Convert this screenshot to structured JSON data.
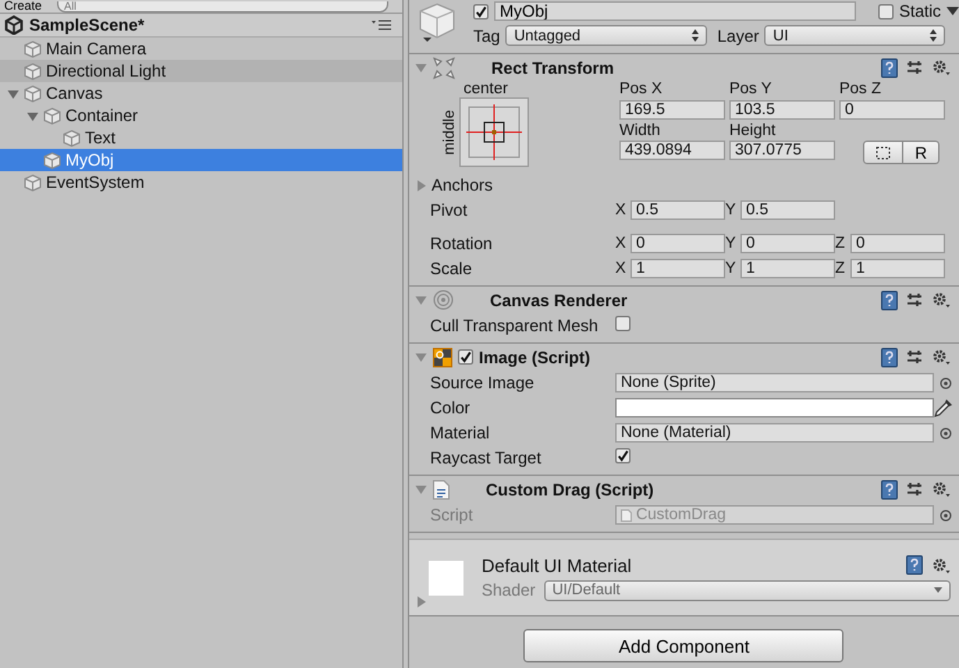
{
  "hierarchy": {
    "toolbar": {
      "create_label": "Create",
      "search_placeholder": "All"
    },
    "scene": {
      "name": "SampleScene*"
    },
    "items": [
      {
        "name": "Main Camera",
        "selected": false,
        "highlighted": false
      },
      {
        "name": "Directional Light",
        "selected": false,
        "highlighted": true
      },
      {
        "name": "Canvas",
        "selected": false,
        "highlighted": false,
        "expanded": true,
        "children": [
          {
            "name": "Container",
            "selected": false,
            "highlighted": false,
            "expanded": true,
            "children": [
              {
                "name": "Text",
                "selected": false,
                "highlighted": false
              }
            ]
          },
          {
            "name": "MyObj",
            "selected": true,
            "highlighted": false
          }
        ]
      },
      {
        "name": "EventSystem",
        "selected": false,
        "highlighted": false
      }
    ]
  },
  "inspector": {
    "object": {
      "active": true,
      "name": "MyObj",
      "static": false,
      "static_label": "Static",
      "tag_label": "Tag",
      "tag": "Untagged",
      "layer_label": "Layer",
      "layer": "UI"
    },
    "components": [
      {
        "kind": "rect_transform",
        "title": "Rect Transform",
        "expanded": true,
        "anchor_h": "center",
        "anchor_v": "middle",
        "top_fields": [
          {
            "label": "Pos X",
            "value": "169.5"
          },
          {
            "label": "Pos Y",
            "value": "103.5"
          },
          {
            "label": "Pos Z",
            "value": "0"
          },
          {
            "label": "Width",
            "value": "439.0894"
          },
          {
            "label": "Height",
            "value": "307.0775"
          }
        ],
        "raw_button": "R",
        "anchors": {
          "label": "Anchors",
          "expanded": false
        },
        "rows": [
          {
            "label": "Pivot",
            "axes": [
              {
                "axis": "X",
                "value": "0.5"
              },
              {
                "axis": "Y",
                "value": "0.5"
              }
            ]
          },
          {
            "label": "Rotation",
            "axes": [
              {
                "axis": "X",
                "value": "0"
              },
              {
                "axis": "Y",
                "value": "0"
              },
              {
                "axis": "Z",
                "value": "0"
              }
            ]
          },
          {
            "label": "Scale",
            "axes": [
              {
                "axis": "X",
                "value": "1"
              },
              {
                "axis": "Y",
                "value": "1"
              },
              {
                "axis": "Z",
                "value": "1"
              }
            ]
          }
        ]
      },
      {
        "kind": "canvas_renderer",
        "title": "Canvas Renderer",
        "expanded": true,
        "props": [
          {
            "kind": "checkbox",
            "label": "Cull Transparent Mesh",
            "checked": false
          }
        ]
      },
      {
        "kind": "image",
        "title": "Image (Script)",
        "expanded": true,
        "enabled": true,
        "props": [
          {
            "kind": "object",
            "label": "Source Image",
            "value": "None (Sprite)"
          },
          {
            "kind": "color",
            "label": "Color",
            "color": "#ffffff"
          },
          {
            "kind": "object",
            "label": "Material",
            "value": "None (Material)"
          },
          {
            "kind": "checkbox",
            "label": "Raycast Target",
            "checked": true
          }
        ]
      },
      {
        "kind": "script",
        "title": "Custom Drag (Script)",
        "expanded": true,
        "props": [
          {
            "kind": "script",
            "label": "Script",
            "value": "CustomDrag"
          }
        ]
      }
    ],
    "material": {
      "name": "Default UI Material",
      "expanded": false,
      "shader_label": "Shader",
      "shader": "UI/Default"
    },
    "add_button": "Add Component"
  }
}
